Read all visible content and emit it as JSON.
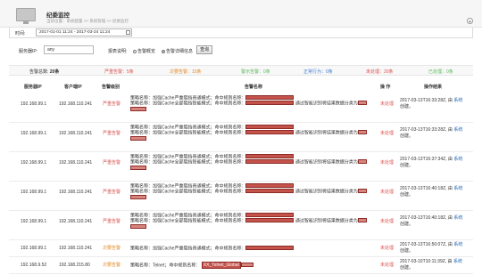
{
  "header": {
    "title": "纪委监控",
    "breadcrumb": "当前位置：系统配置 >> 系统管理 >> 纪委监控",
    "collapse_glyph": "▴"
  },
  "timebar": {
    "label": "时间:",
    "range": "2017-01-01 11:24 - 2017-03-24 11:24"
  },
  "filter": {
    "ip_label": "服务器IP:",
    "ip_value": "any",
    "mode_label": "报表说明:",
    "mode_overview": "告警概览",
    "mode_detail": "告警详细信息",
    "query_button": "查询"
  },
  "summary": {
    "total_label": "告警总数:",
    "total": "20条",
    "critical": "严重告警：5条",
    "minor": "次要告警：15条",
    "warning": "警示告警：0条",
    "normal": "正常行为：0条",
    "unhandled": "未处理：20条",
    "handled": "已处理：0条"
  },
  "colors": {
    "critical": "#d9534f",
    "minor": "#e08a28",
    "warning": "#5cb85c",
    "normal": "#3a7bd5",
    "link": "#2a6ebb"
  },
  "table": {
    "headers": [
      "服务器IP",
      "客户端IP",
      "告警级别",
      "告警名称",
      "操 作",
      "操作结果"
    ],
    "rows": [
      {
        "server_ip": "192.168.99.1",
        "client_ip": "192.168.110.241",
        "level": "严重告警",
        "policy_1": "策略名称：加强Cache严重阻挡普通模式；命中规则名称：",
        "policy_2": "策略名称：加强Cache全部阻挡智能模式；命中规则名称：",
        "policy_2_tail": "通过智能识别将结果数据分类为",
        "action": "未处理",
        "time": "2017-03-13T16:33:28Z, 由",
        "sys": "系统",
        "created": "创建。"
      },
      {
        "server_ip": "192.168.99.1",
        "client_ip": "192.168.110.241",
        "level": "严重告警",
        "policy_1": "策略名称：加强Cache严重阻挡普通模式；命中规则名称：",
        "policy_2": "策略名称：加强Cache全部阻挡智能模式；命中规则名称：",
        "policy_2_tail": "通过智能识别将结果数据分类为",
        "action": "未处理",
        "time": "2017-03-13T16:33:28Z, 由",
        "sys": "系统",
        "created": "创建。"
      },
      {
        "server_ip": "192.168.99.1",
        "client_ip": "192.168.110.241",
        "level": "严重告警",
        "policy_1": "策略名称：加强Cache严重阻挡普通模式；命中规则名称：",
        "policy_2": "策略名称：加强Cache全部阻挡智能模式；命中规则名称：",
        "policy_2_tail": "通过智能识别将结果数据分类为",
        "action": "未处理",
        "time": "2017-03-13T16:37:34Z, 由",
        "sys": "系统",
        "created": "创建。"
      },
      {
        "server_ip": "192.168.99.1",
        "client_ip": "192.168.110.241",
        "level": "严重告警",
        "policy_1": "策略名称：加强Cache严重阻挡普通模式；命中规则名称：",
        "policy_2": "策略名称：加强Cache全部阻挡智能模式；命中规则名称：",
        "policy_2_tail": "通过智能识别将结果数据分类为",
        "action": "未处理",
        "time": "2017-03-13T16:40:18Z, 由",
        "sys": "系统",
        "created": "创建。"
      },
      {
        "server_ip": "192.168.99.1",
        "client_ip": "192.168.110.241",
        "level": "严重告警",
        "policy_1": "策略名称：加强Cache严重阻挡普通模式；命中规则名称：",
        "policy_2": "策略名称：加强Cache全部阻挡智能模式；命中规则名称：",
        "policy_2_tail": "通过智能识别将结果数据分类为",
        "action": "未处理",
        "time": "2017-03-13T16:40:18Z, 由",
        "sys": "系统",
        "created": "创建。"
      },
      {
        "server_ip": "192.168.99.1",
        "client_ip": "192.168.110.241",
        "level": "次要告警",
        "policy_1": "策略名称：加强Cache严重阻挡普通模式；命中规则名称：",
        "action": "未处理",
        "time": "2017-03-13T16:50:07Z, 由",
        "sys": "系统",
        "created": "创建。"
      },
      {
        "server_ip": "192.168.9.52",
        "client_ip": "192.168.215.80",
        "level": "次要告警",
        "policy_1": "策略名称：Telnet；命中规则名称：",
        "policy_1_rule": "XX_Telnet_Global",
        "action": "未处理",
        "time": "2017-03-10T10:11:39Z, 由",
        "sys": "系统",
        "created": "创建。"
      }
    ]
  }
}
